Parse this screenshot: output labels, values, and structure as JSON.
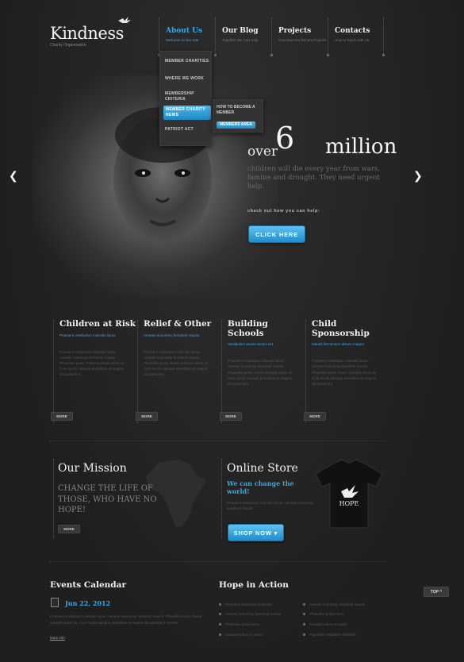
{
  "brand": {
    "name": "Kindness",
    "tagline": "Charity Organization",
    "logo_icon": "dove-icon"
  },
  "nav": [
    {
      "label": "About Us",
      "sub": "Welcome to Our Site",
      "active": true
    },
    {
      "label": "Our Blog",
      "sub": "Together We Can Help"
    },
    {
      "label": "Projects",
      "sub": "Overview Our Recent Projects"
    },
    {
      "label": "Contacts",
      "sub": "How to Touch with Us"
    }
  ],
  "dropdown": {
    "items": [
      "MEMBER CHARITIES",
      "WHERE WE WORK",
      "MEMBERSHIP CRITERIA",
      "MEMBER CHARITY NEWS",
      "PATRIOT ACT"
    ],
    "active_index": 3,
    "submenu": [
      "HOW TO BECOME A MEMBER",
      "MEMBERS AREA"
    ],
    "submenu_active_index": 1
  },
  "hero": {
    "over": "over",
    "big_number": "6",
    "million": "million",
    "subtitle": "children will die every year from wars, famine and drought. They need urgent help.",
    "check": "check out how you can help:",
    "button": "CLICK HERE",
    "prev_icon": "chevron-left-icon",
    "next_icon": "chevron-right-icon"
  },
  "features": [
    {
      "title": "Children at Risk",
      "sub": "Praesent vestibulum molestie lacus",
      "body": "Praesent vestibulum molestie lacus. Aenean nonummy hendrerit mauris. Phasellus porta. Fusce suscipit varius mi. Cum sociis natoque penatibus et magnis dis parturient.",
      "more": "MORE"
    },
    {
      "title": "Relief & Other",
      "sub": "Aenean nonummy hendrerit mauris",
      "body": "Praesent vestibulum molestie lacus. Aenean nonummy hendrerit mauris. Phasellus porta. Fusce suscipit varius mi. Cum sociis natoque penatibus et magnis dis parturient.",
      "more": "MORE"
    },
    {
      "title": "Building Schools",
      "sub": "Vestibulum iaculis lacinia est",
      "body": "Praesent vestibulum molestie lacus. Aenean nonummy hendrerit mauris. Phasellus porta. Fusce suscipit varius mi. Cum sociis natoque penatibus et magnis dis parturient.",
      "more": "MORE"
    },
    {
      "title": "Child Sponsorship",
      "sub": "Mauris fermentum dictum magna",
      "body": "Praesent vestibulum molestie lacus. Aenean nonummy hendrerit mauris. Phasellus porta. Fusce suscipit varius mi. Cum sociis natoque penatibus et magnis dis parturient.",
      "more": "MORE"
    }
  ],
  "mission": {
    "title": "Our Mission",
    "text": "CHANGE THE LIFE OF THOSE, WHO HAVE NO HOPE!",
    "more": "MORE"
  },
  "store": {
    "title": "Online Store",
    "subtitle": "We can change the world!",
    "body": "Praesent vestibulum molestie lacus. Aenean nonummy hendrerit mauris.",
    "button": "SHOP NOW",
    "shirt_text": "HOPE"
  },
  "events": {
    "title": "Events Calendar",
    "date": "Jun 22, 2012",
    "body": "Praesent vestibulum molestie lacus. Aenean nonummy hendrerit mauris. Phasellus porta. Fusce suscipit varius mi. Cum sociis natoque penatibus et magnis dis parturient montes.",
    "more": "More info"
  },
  "hope": {
    "title": "Hope in Action",
    "col1": [
      "Praesent vestibulum molestie",
      "Aenean nonummy hendrerit mauris",
      "Phasellus porta fusce",
      "Suscipit varius mi sociis"
    ],
    "col2": [
      "Aenean nonummy hendrerit mauris",
      "Phasellus porta fusce",
      "Suscipit varius mi sociis",
      "Praesent vestibulum molestie"
    ]
  },
  "top_button": "TOP ^",
  "colors": {
    "accent": "#3aa8e0",
    "background": "#232323"
  }
}
